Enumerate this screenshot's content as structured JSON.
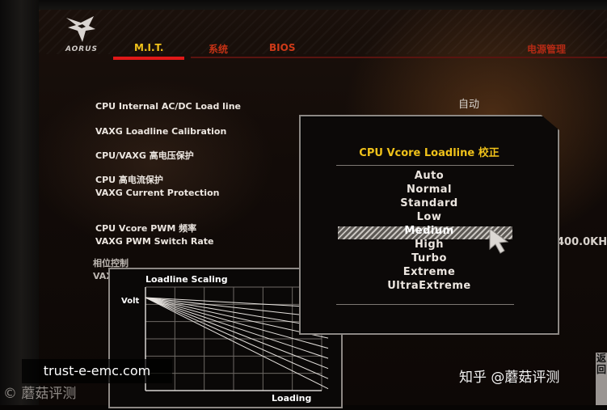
{
  "logo": {
    "text": "AORUS"
  },
  "tabs": [
    {
      "label": "M.I.T.",
      "active": true
    },
    {
      "label": "系统"
    },
    {
      "label": "BIOS"
    },
    {
      "label": ""
    },
    {
      "label": ""
    },
    {
      "label": ""
    },
    {
      "label": "电源管理"
    }
  ],
  "settings": [
    {
      "label": "CPU Internal AC/DC Load line",
      "value": "自动"
    },
    {
      "label": "VAXG Loadline Calibration"
    },
    {
      "label": "CPU/VAXG 高电压保护"
    },
    {
      "label": "CPU 高电流保护",
      "label2": "VAXG Current Protection"
    },
    {
      "label": "CPU Vcore PWM 频率",
      "label2": "VAXG PWM Switch Rate",
      "value": "400.0KH"
    },
    {
      "label": "相位控制",
      "label2": "VAX"
    }
  ],
  "popup": {
    "title": "CPU Vcore Loadline 校正",
    "options": [
      "Auto",
      "Normal",
      "Standard",
      "Low",
      "Medium",
      "High",
      "Turbo",
      "Extreme",
      "UltraExtreme"
    ],
    "selected": "Medium"
  },
  "chart_data": {
    "type": "line",
    "title": "Loadline Scaling",
    "ylabel": "Volt",
    "xlabel": "Loading",
    "series_count": 9,
    "grid": true
  },
  "icons": {
    "cursor": "mouse-pointer-icon",
    "logo": "aorus-eagle-icon"
  },
  "colors": {
    "accent": "#f0c21a",
    "tab_red": "#e01818",
    "background": "#120b08"
  },
  "watermarks": {
    "url": "trust-e-emc.com",
    "cn_left": "© 蘑菇评测",
    "zhihu": "知乎 @蘑菇评测",
    "side": "返回"
  }
}
